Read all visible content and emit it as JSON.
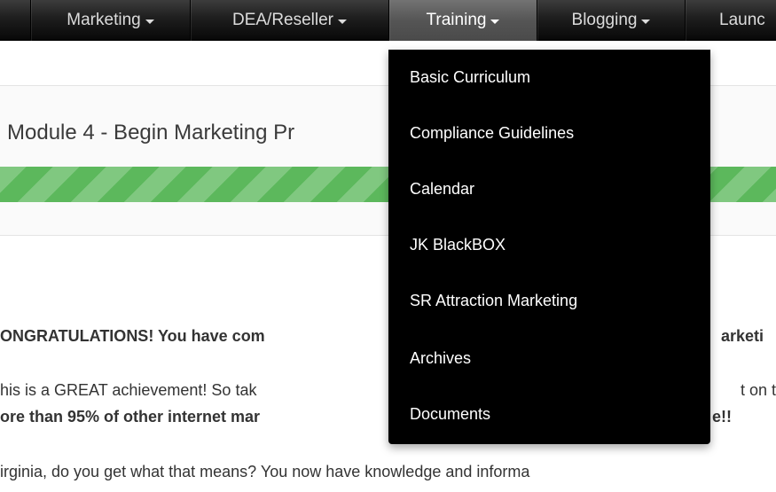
{
  "navbar": {
    "items": [
      {
        "label": "Marketing",
        "active": false,
        "has_caret": true
      },
      {
        "label": "DEA/Reseller",
        "active": false,
        "has_caret": true
      },
      {
        "label": "Training",
        "active": true,
        "has_caret": true
      },
      {
        "label": "Blogging",
        "active": false,
        "has_caret": true
      },
      {
        "label": "Launc",
        "active": false,
        "has_caret": false
      }
    ],
    "caret_icon": "caret-down-icon"
  },
  "module": {
    "title": "Module 4 - Begin Marketing Pr",
    "progress_percent": 100,
    "progress_color": "#5cb85c"
  },
  "content": {
    "congrats_left": "ONGRATULATIONS! You have com",
    "congrats_right": "arketi",
    "great_left": "his is a GREAT achievement! So tak",
    "great_right": "t on th",
    "more_left": "ore than 95% of other internet mar",
    "more_right": "e!!",
    "virginia": "irginia, do you get what that means? You now have knowledge and informa"
  },
  "dropdown": {
    "open_for": "Training",
    "items": [
      {
        "label": "Basic Curriculum"
      },
      {
        "label": "Compliance Guidelines"
      },
      {
        "label": "Calendar"
      },
      {
        "label": "JK BlackBOX"
      },
      {
        "label": "SR Attraction Marketing"
      },
      {
        "label": "Archives"
      },
      {
        "label": "Documents"
      }
    ]
  },
  "colors": {
    "navbar_bg": "#1e1e1e",
    "navbar_active": "#555555",
    "dropdown_bg": "#000000",
    "progress_green": "#5cb85c"
  }
}
